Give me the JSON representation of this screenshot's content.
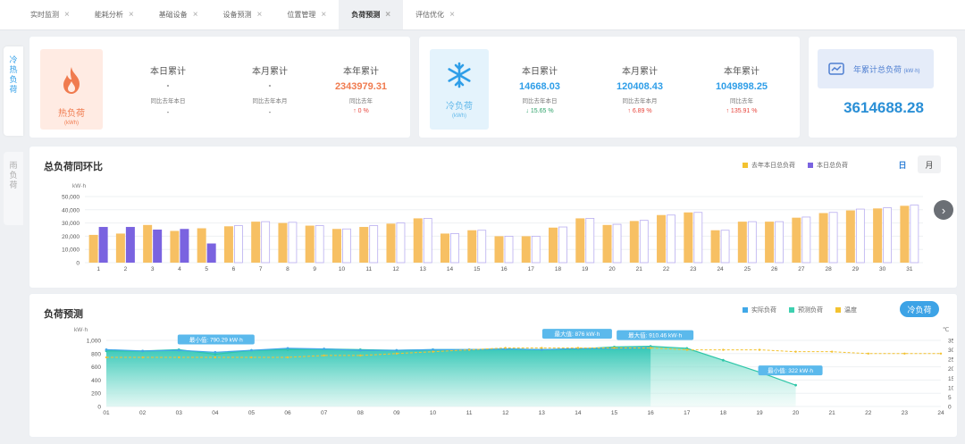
{
  "tabs": [
    {
      "label": "实时监测",
      "active": false
    },
    {
      "label": "能耗分析",
      "active": false
    },
    {
      "label": "基础设备",
      "active": false
    },
    {
      "label": "设备预测",
      "active": false
    },
    {
      "label": "位置管理",
      "active": false
    },
    {
      "label": "负荷预测",
      "active": true
    },
    {
      "label": "评估优化",
      "active": false
    }
  ],
  "side_tabs": {
    "cold": [
      "冷",
      "热",
      "负",
      "荷"
    ],
    "rain": [
      "雨",
      "负",
      "荷"
    ]
  },
  "hot": {
    "label": "热负荷",
    "unit": "(kWh)",
    "metrics": [
      {
        "title": "本日累计",
        "value": "-",
        "compare": "同比去年本日",
        "pct": "-"
      },
      {
        "title": "本月累计",
        "value": "-",
        "compare": "同比去年本月",
        "pct": "-"
      },
      {
        "title": "本年累计",
        "value": "2343979.31",
        "compare": "同比去年",
        "pct": "↑ 0 %"
      }
    ]
  },
  "cold": {
    "label": "冷负荷",
    "unit": "(kWh)",
    "metrics": [
      {
        "title": "本日累计",
        "value": "14668.03",
        "compare": "同比去年本日",
        "pct": "↓ 15.65 %"
      },
      {
        "title": "本月累计",
        "value": "120408.43",
        "compare": "同比去年本月",
        "pct": "↑ 6.89 %"
      },
      {
        "title": "本年累计",
        "value": "1049898.25",
        "compare": "同比去年",
        "pct": "↑ 135.91 %"
      }
    ]
  },
  "year_total": {
    "label": "年累计总负荷",
    "unit": "(kW·h)",
    "value": "3614688.28"
  },
  "colors": {
    "accent": "#2f9ee8",
    "hot": "#f07b4f",
    "up": "#e8453c",
    "down": "#2fa36b",
    "last_year_bar": "#f7c063",
    "this_year_bar": "#7a63e0",
    "actual": "#40a8e8",
    "forecast": "#3ed0b0",
    "temp": "#f3c230"
  },
  "chart1": {
    "title": "总负荷同环比",
    "legend": [
      "去年本日总负荷",
      "本日总负荷"
    ],
    "day_btn": "日",
    "month_btn": "月"
  },
  "chart2": {
    "title": "负荷预测",
    "legend": [
      "实际负荷",
      "预测负荷",
      "温度"
    ],
    "toggle": "冷负荷",
    "callouts": [
      "最小值: 790.29 kW·h",
      "最大值: 876 kW·h",
      "最大值: 910.46 kW·h",
      "最小值: 322 kW·h"
    ]
  },
  "chart_data": [
    {
      "type": "bar",
      "title": "总负荷同环比",
      "ylabel": "kW·h",
      "ylim": [
        0,
        50000
      ],
      "yticks": [
        "50,000",
        "40,000",
        "30,000",
        "20,000",
        "10,000",
        "0"
      ],
      "categories": [
        "1",
        "2",
        "3",
        "4",
        "5",
        "6",
        "7",
        "8",
        "9",
        "10",
        "11",
        "12",
        "13",
        "14",
        "15",
        "16",
        "17",
        "18",
        "19",
        "20",
        "21",
        "22",
        "23",
        "24",
        "25",
        "26",
        "27",
        "28",
        "29",
        "30",
        "31"
      ],
      "series": [
        {
          "name": "去年本日总负荷",
          "values": [
            21000,
            22000,
            28500,
            24000,
            26000,
            27500,
            31000,
            30000,
            28000,
            25500,
            27000,
            29500,
            33500,
            22000,
            24500,
            20000,
            20000,
            26500,
            33500,
            28500,
            31500,
            36000,
            38000,
            24500,
            31000,
            31000,
            34000,
            37500,
            39500,
            41000,
            43000
          ]
        },
        {
          "name": "本日总负荷",
          "values": [
            27000,
            27000,
            25000,
            25500,
            14500,
            28000,
            31000,
            30500,
            28000,
            25500,
            28000,
            30000,
            33500,
            22000,
            24500,
            20000,
            20000,
            27000,
            33500,
            29000,
            32000,
            36000,
            38000,
            24500,
            31000,
            31000,
            34500,
            38000,
            40500,
            41500,
            43500
          ]
        }
      ]
    },
    {
      "type": "area",
      "title": "负荷预测",
      "ylabel": "kW·h",
      "y2label": "℃",
      "ylim": [
        0,
        1000
      ],
      "y2lim": [
        0,
        35
      ],
      "yticks": [
        "1,000",
        "800",
        "600",
        "400",
        "200",
        "0"
      ],
      "y2ticks": [
        "35",
        "30",
        "25",
        "20",
        "15",
        "10",
        "5",
        "0"
      ],
      "categories": [
        "01",
        "02",
        "03",
        "04",
        "05",
        "06",
        "07",
        "08",
        "09",
        "10",
        "11",
        "12",
        "13",
        "14",
        "15",
        "16",
        "17",
        "18",
        "19",
        "20",
        "21",
        "22",
        "23",
        "24"
      ],
      "series": [
        {
          "name": "实际负荷",
          "values": [
            860,
            840,
            850,
            820,
            850,
            880,
            870,
            850,
            850,
            860,
            860,
            870,
            860,
            876,
            880,
            890
          ]
        },
        {
          "name": "预测负荷",
          "values": [
            840,
            840,
            860,
            790,
            850,
            860,
            870,
            860,
            850,
            860,
            860,
            870,
            860,
            870,
            900,
            910,
            880,
            700,
            520,
            322
          ]
        },
        {
          "name": "温度",
          "values": [
            26,
            26,
            26,
            26,
            26,
            26,
            27,
            27,
            28,
            29,
            30,
            31,
            31,
            31,
            31,
            31,
            30,
            30,
            30,
            29,
            29,
            28,
            28,
            28
          ]
        }
      ]
    }
  ]
}
